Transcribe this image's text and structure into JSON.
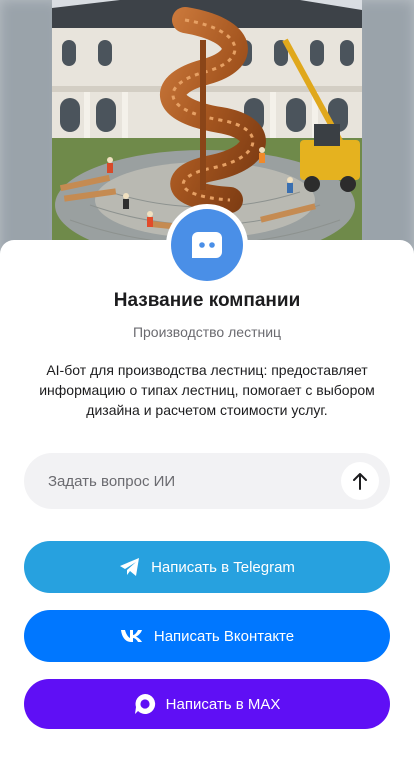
{
  "hero": {
    "image": "spiral-staircase-construction-photo"
  },
  "avatar": {
    "icon": "chat-bot-icon",
    "color": "#4a8fe7"
  },
  "company": {
    "name": "Название компании",
    "category": "Производство лестниц",
    "description": "AI-бот для производства лестниц: предоставляет информацию о типах лестниц, помогает с выбором дизайна и расчетом стоимости услуг."
  },
  "ask": {
    "placeholder": "Задать вопрос ИИ",
    "value": "",
    "send_icon": "arrow-up-icon"
  },
  "buttons": {
    "telegram": {
      "label": "Написать в Telegram",
      "icon": "telegram-icon",
      "color": "#27a1df"
    },
    "vk": {
      "label": "Написать Вконтакте",
      "icon": "vk-icon",
      "color": "#0077ff"
    },
    "max": {
      "label": "Написать в MAX",
      "icon": "max-icon",
      "color": "#5f0ff5"
    }
  }
}
